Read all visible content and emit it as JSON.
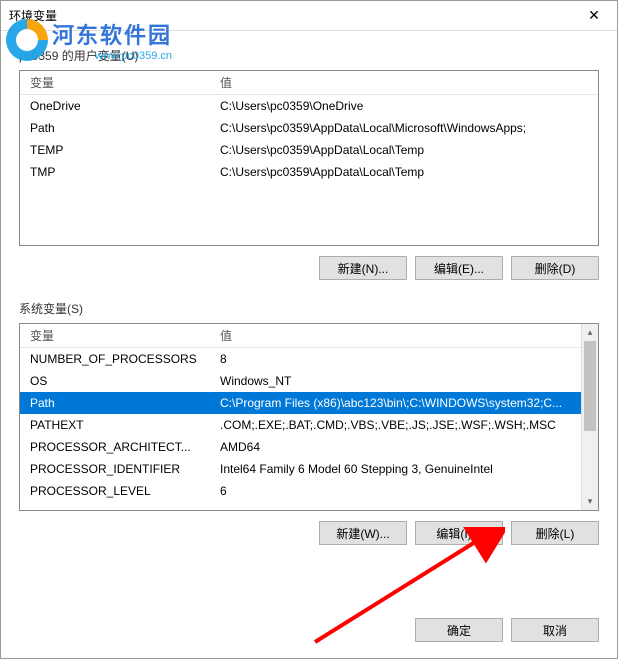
{
  "window": {
    "title": "环境变量"
  },
  "watermark": {
    "name": "河东软件园",
    "url": "www.pc0359.cn"
  },
  "user_section": {
    "label": "pc0359 的用户变量(U)",
    "headers": {
      "var": "变量",
      "val": "值"
    },
    "rows": [
      {
        "var": "OneDrive",
        "val": "C:\\Users\\pc0359\\OneDrive"
      },
      {
        "var": "Path",
        "val": "C:\\Users\\pc0359\\AppData\\Local\\Microsoft\\WindowsApps;"
      },
      {
        "var": "TEMP",
        "val": "C:\\Users\\pc0359\\AppData\\Local\\Temp"
      },
      {
        "var": "TMP",
        "val": "C:\\Users\\pc0359\\AppData\\Local\\Temp"
      }
    ],
    "buttons": {
      "new": "新建(N)...",
      "edit": "编辑(E)...",
      "delete": "删除(D)"
    }
  },
  "sys_section": {
    "label": "系统变量(S)",
    "headers": {
      "var": "变量",
      "val": "值"
    },
    "rows": [
      {
        "var": "NUMBER_OF_PROCESSORS",
        "val": "8"
      },
      {
        "var": "OS",
        "val": "Windows_NT"
      },
      {
        "var": "Path",
        "val": "C:\\Program Files (x86)\\abc123\\bin\\;C:\\WINDOWS\\system32;C..."
      },
      {
        "var": "PATHEXT",
        "val": ".COM;.EXE;.BAT;.CMD;.VBS;.VBE;.JS;.JSE;.WSF;.WSH;.MSC"
      },
      {
        "var": "PROCESSOR_ARCHITECT...",
        "val": "AMD64"
      },
      {
        "var": "PROCESSOR_IDENTIFIER",
        "val": "Intel64 Family 6 Model 60 Stepping 3, GenuineIntel"
      },
      {
        "var": "PROCESSOR_LEVEL",
        "val": "6"
      }
    ],
    "selected_index": 2,
    "buttons": {
      "new": "新建(W)...",
      "edit": "编辑(I)...",
      "delete": "删除(L)"
    }
  },
  "footer": {
    "ok": "确定",
    "cancel": "取消"
  }
}
